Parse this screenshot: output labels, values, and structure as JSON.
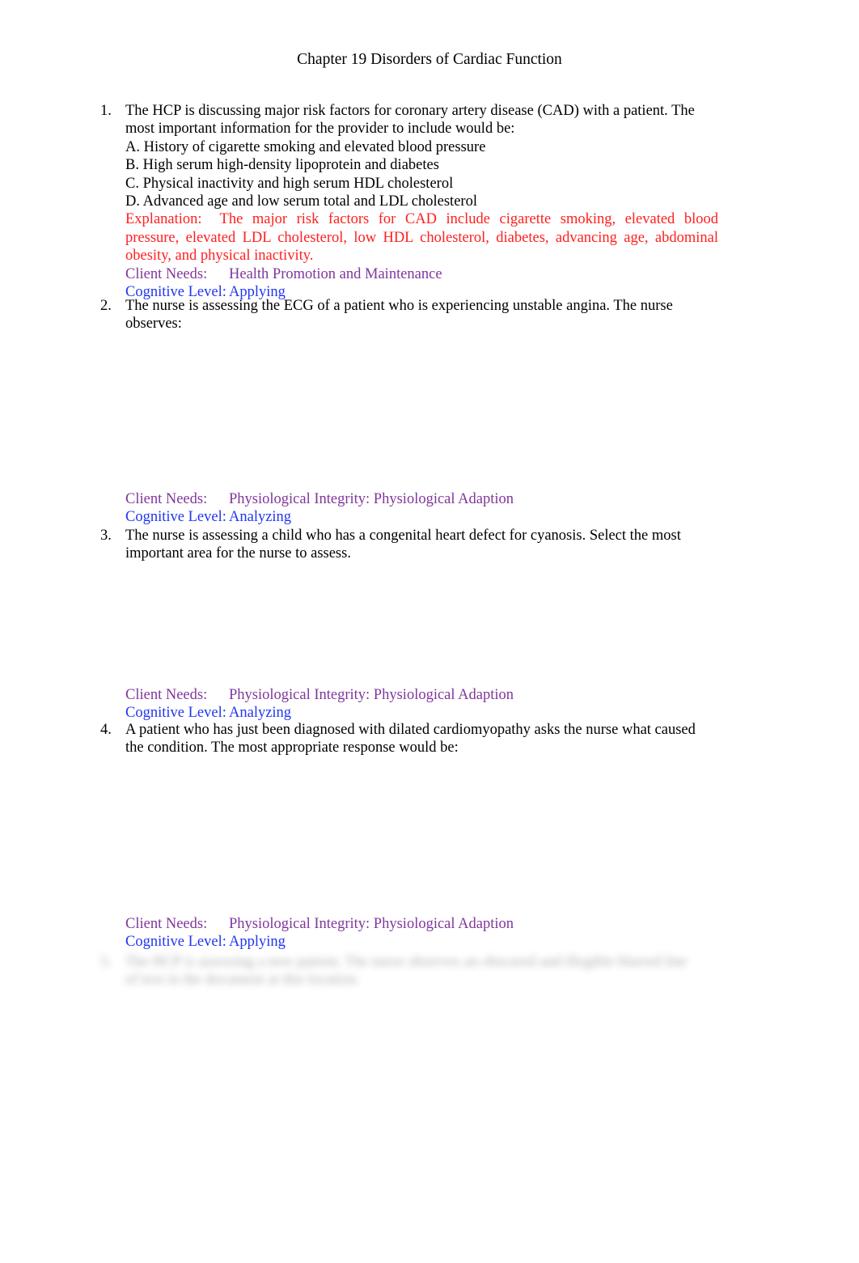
{
  "document": {
    "title": "Chapter 19 Disorders of Cardiac Function",
    "labels": {
      "explanation": "Explanation:",
      "client_needs": "Client Needs:",
      "cognitive_level": "Cognitive Level:"
    },
    "colors": {
      "body_text": "#000000",
      "explanation": "#ff2020",
      "client_needs": "#80379b",
      "cognitive_level": "#2136f0",
      "page_background": "#ffffff"
    }
  },
  "questions": [
    {
      "number": "1.",
      "stem": "The HCP is discussing major risk factors for coronary artery disease (CAD) with a patient. The most important information for the provider to include would be:",
      "options": [
        "A. History of cigarette smoking and elevated blood pressure",
        "B. High serum high-density lipoprotein and diabetes",
        "C. Physical inactivity and high serum HDL cholesterol",
        "D. Advanced age and low serum total and LDL cholesterol"
      ],
      "explanation": "The major risk factors for CAD include cigarette smoking, elevated blood pressure, elevated LDL cholesterol, low HDL cholesterol, diabetes, advancing age, abdominal obesity, and physical inactivity.",
      "client_needs": "Health Promotion and Maintenance",
      "cognitive_level": "Applying"
    },
    {
      "number": "2.",
      "stem": "The nurse is assessing the ECG of a patient who is experiencing unstable angina. The nurse observes:",
      "options": [],
      "explanation": "",
      "client_needs": "Physiological Integrity: Physiological Adaption",
      "cognitive_level": "Analyzing"
    },
    {
      "number": "3.",
      "stem": "The nurse is assessing a child who has a congenital heart defect for cyanosis. Select the most important area for the nurse to assess.",
      "options": [],
      "explanation": "",
      "client_needs": "Physiological Integrity: Physiological Adaption",
      "cognitive_level": "Analyzing"
    },
    {
      "number": "4.",
      "stem": "A patient who has just been diagnosed with dilated cardiomyopathy asks the nurse what caused the condition. The most appropriate response would be:",
      "options": [],
      "explanation": "",
      "client_needs": "Physiological Integrity: Physiological Adaption",
      "cognitive_level": "Applying"
    }
  ],
  "obscured_question": {
    "number": "5.",
    "stem": "The HCP is assessing a new patient. The nurse observes an obscured and illegible blurred line of text in the document at this location."
  }
}
